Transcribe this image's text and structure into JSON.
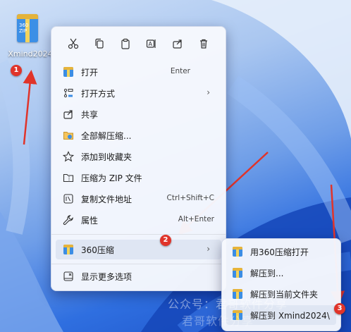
{
  "desktop": {
    "icon_label": "Xmind2024",
    "icon_badge_text": "360\nZIP"
  },
  "badges": [
    "1",
    "2",
    "3"
  ],
  "toolbar": {
    "icons": [
      "cut-icon",
      "copy-icon",
      "paste-icon",
      "rename-icon",
      "share-icon",
      "delete-icon"
    ]
  },
  "menu": {
    "items": [
      {
        "label": "打开",
        "shortcut": "Enter",
        "icon": "zip-icon"
      },
      {
        "label": "打开方式",
        "shortcut": "",
        "icon": "open-with-icon",
        "submenu": true
      },
      {
        "label": "共享",
        "shortcut": "",
        "icon": "share-icon"
      },
      {
        "label": "全部解压缩...",
        "shortcut": "",
        "icon": "extract-all-icon"
      },
      {
        "label": "添加到收藏夹",
        "shortcut": "",
        "icon": "star-icon"
      },
      {
        "label": "压缩为 ZIP 文件",
        "shortcut": "",
        "icon": "zip-folder-icon"
      },
      {
        "label": "复制文件地址",
        "shortcut": "Ctrl+Shift+C",
        "icon": "copy-path-icon"
      },
      {
        "label": "属性",
        "shortcut": "Alt+Enter",
        "icon": "wrench-icon"
      },
      {
        "label": "360压缩",
        "shortcut": "",
        "icon": "zip-icon",
        "submenu": true
      },
      {
        "label": "显示更多选项",
        "shortcut": "",
        "icon": "more-options-icon"
      }
    ]
  },
  "submenu": {
    "items": [
      {
        "label": "用360压缩打开"
      },
      {
        "label": "解压到..."
      },
      {
        "label": "解压到当前文件夹"
      },
      {
        "label": "解压到 Xmind2024\\"
      }
    ]
  },
  "watermark": {
    "line1": "公众号：君哥软件分享",
    "line2": "君哥软件分享"
  },
  "colors": {
    "badge": "#e0342a",
    "arrow": "#e0342a",
    "menu_bg": "#f6f8fd",
    "hover": "#dfe6f3"
  }
}
